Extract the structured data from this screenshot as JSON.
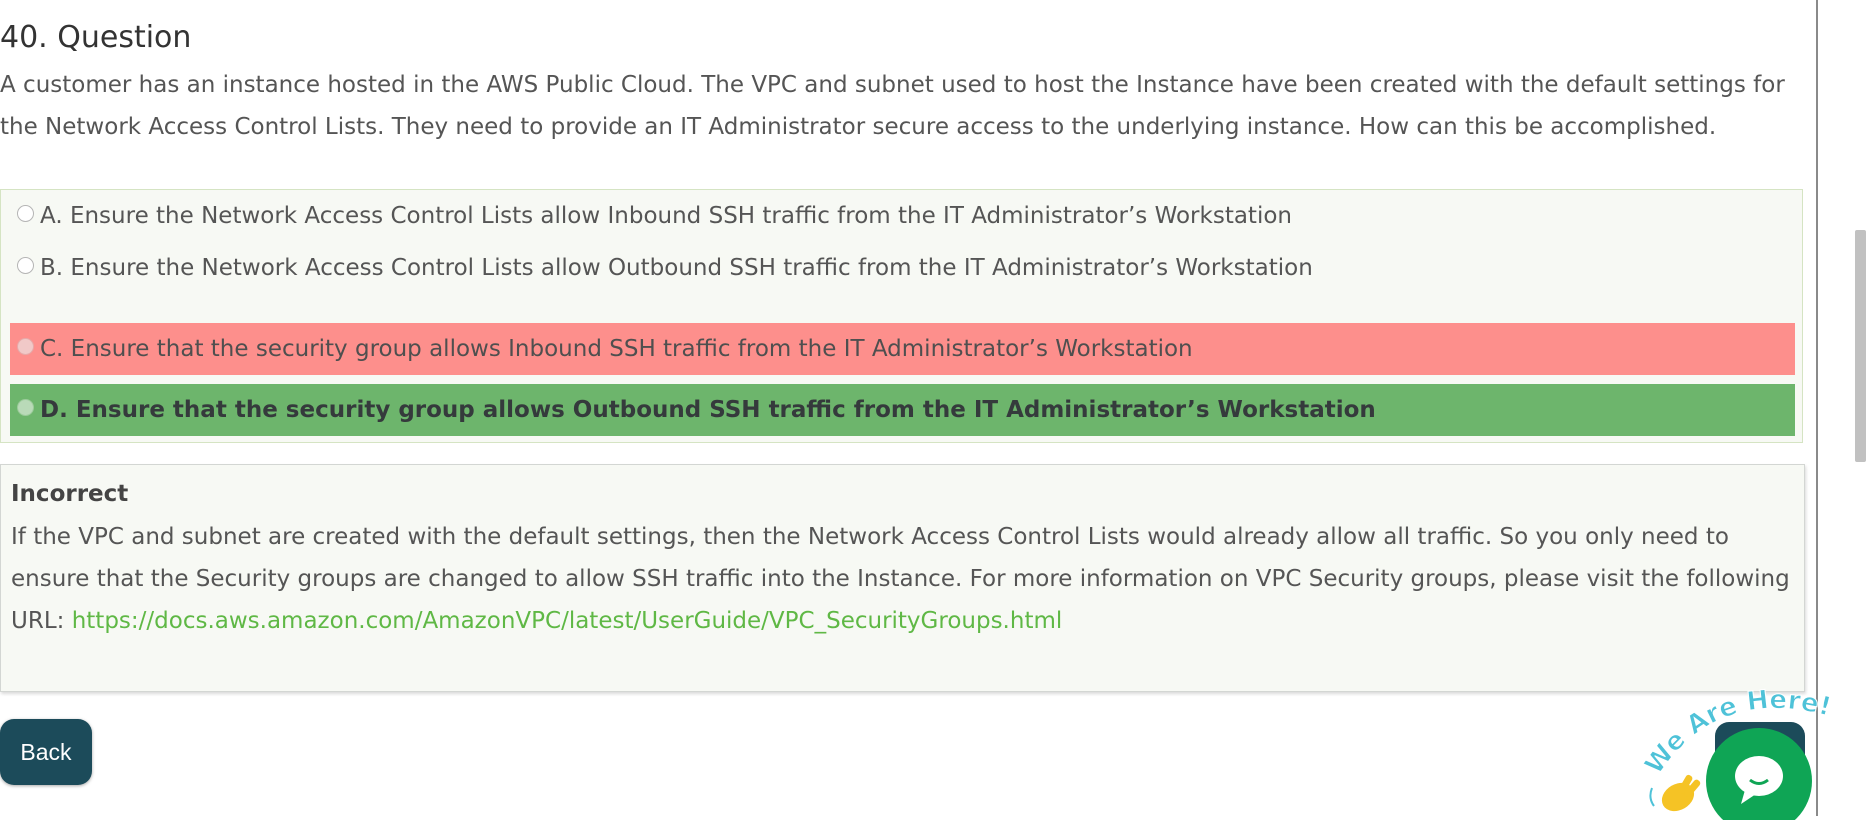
{
  "question": {
    "title": "40. Question",
    "text": "A customer has an instance hosted in the AWS Public Cloud. The VPC and subnet used to host the Instance have been created with the default settings for the Network Access Control Lists. They need to provide an IT Administrator secure access to the underlying instance. How can this be accomplished."
  },
  "options": [
    {
      "label": "A. Ensure the Network Access Control Lists allow Inbound SSH traffic from the IT Administrator’s Workstation",
      "state": "neutral"
    },
    {
      "label": "B. Ensure the Network Access Control Lists allow Outbound SSH traffic from the IT Administrator’s Workstation",
      "state": "neutral"
    },
    {
      "label": "C. Ensure that the security group allows Inbound SSH traffic from the IT Administrator’s Workstation",
      "state": "wrong"
    },
    {
      "label": "D. Ensure that the security group allows Outbound SSH traffic from the IT Administrator’s Workstation",
      "state": "correct"
    }
  ],
  "explanation": {
    "heading": "Incorrect",
    "text": "If the VPC and subnet are created with the default settings, then the Network Access Control Lists would already allow all traffic. So you only need to ensure that the Security groups are changed to allow SSH traffic into the Instance. For more information on VPC Security groups, please visit the following URL: ",
    "link": "https://docs.aws.amazon.com/AmazonVPC/latest/UserGuide/VPC_SecurityGroups.html"
  },
  "buttons": {
    "back": "Back"
  },
  "chat_widget": {
    "text": "We Are Here!",
    "icon": "chat-bubble-icon",
    "wave_icon": "waving-hand-icon"
  },
  "colors": {
    "wrong": "#fd8f8c",
    "correct": "#6db56c",
    "back_button": "#1c4b5a",
    "link": "#5fb845",
    "chat_green": "#0fa555",
    "chat_text": "#4ec2d8"
  }
}
